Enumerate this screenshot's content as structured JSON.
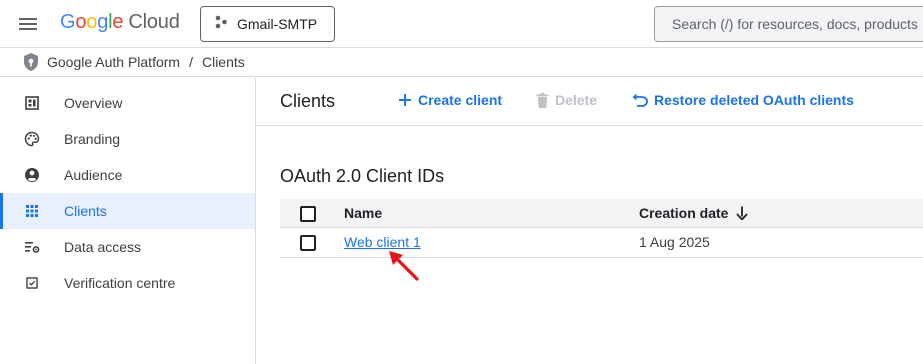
{
  "header": {
    "logo": {
      "letters": [
        "G",
        "o",
        "o",
        "g",
        "l",
        "e"
      ],
      "suffix": "Cloud"
    },
    "project": "Gmail-SMTP",
    "search_placeholder": "Search (/) for resources, docs, products"
  },
  "breadcrumb": {
    "root": "Google Auth Platform",
    "separator": "/",
    "current": "Clients"
  },
  "sidebar": {
    "items": [
      {
        "label": "Overview",
        "icon": "dashboard-icon"
      },
      {
        "label": "Branding",
        "icon": "palette-icon"
      },
      {
        "label": "Audience",
        "icon": "person-icon"
      },
      {
        "label": "Clients",
        "icon": "grid-icon",
        "active": true
      },
      {
        "label": "Data access",
        "icon": "data-access-icon"
      },
      {
        "label": "Verification centre",
        "icon": "checkbox-icon"
      }
    ]
  },
  "main": {
    "title": "Clients",
    "actions": {
      "create": "Create client",
      "delete": "Delete",
      "restore": "Restore deleted OAuth clients"
    },
    "section_title": "OAuth 2.0 Client IDs",
    "table": {
      "columns": {
        "name": "Name",
        "date": "Creation date"
      },
      "rows": [
        {
          "name": "Web client 1",
          "date": "1 Aug 2025"
        }
      ]
    }
  },
  "colors": {
    "accent": "#1a73e8",
    "active_bg": "#e8f0fe",
    "annotation_arrow": "#e8101a"
  }
}
